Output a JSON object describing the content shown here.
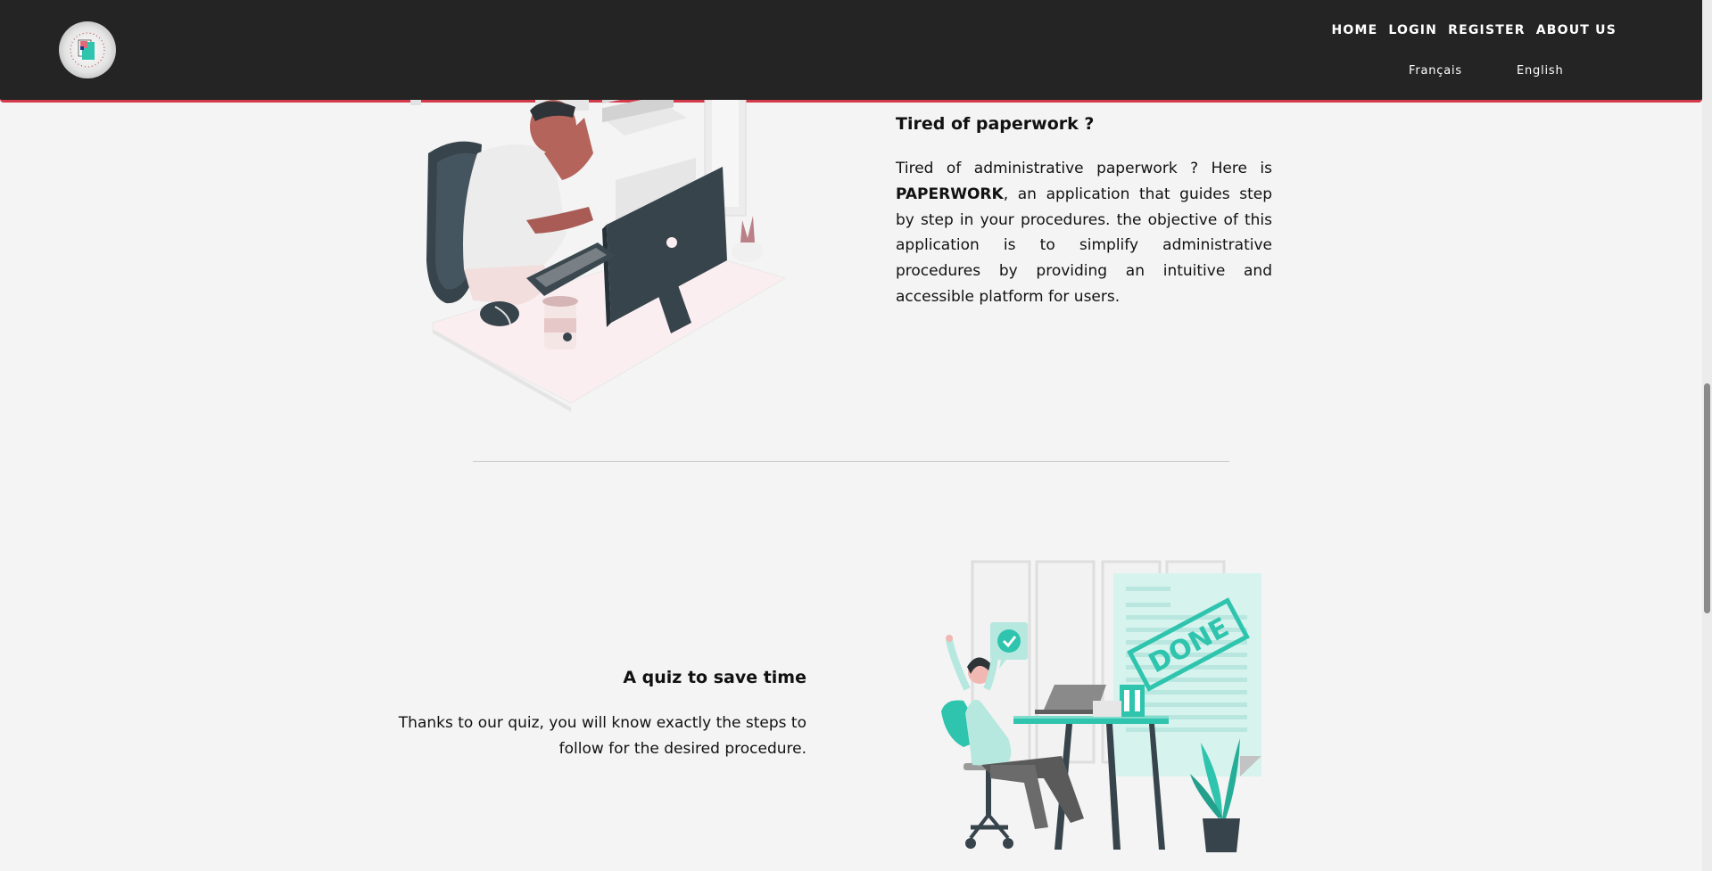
{
  "nav": {
    "links": [
      "HOME",
      "LOGIN",
      "REGISTER",
      "ABOUT US"
    ],
    "languages": [
      "Français",
      "English"
    ]
  },
  "section1": {
    "title": "Tired of paperwork ?",
    "text_before": "Tired of administrative paperwork ? Here is ",
    "brand": "PAPERWORK",
    "text_after": ", an application that guides step by step in your procedures. the objective of this application is to simplify administrative procedures by providing an intuitive and accessible platform for users."
  },
  "section2": {
    "title": "A quiz to save time",
    "text": "Thanks to our quiz, you will know exactly the steps to follow for the desired procedure.",
    "stamp_text": "DONE"
  },
  "colors": {
    "navbar": "#242424",
    "accent_border": "#d43a4a",
    "background": "#f4f4f4",
    "teal": "#2ec4ad",
    "dark_slate": "#37444c"
  },
  "icons": [
    "logo-icon",
    "check-icon"
  ]
}
